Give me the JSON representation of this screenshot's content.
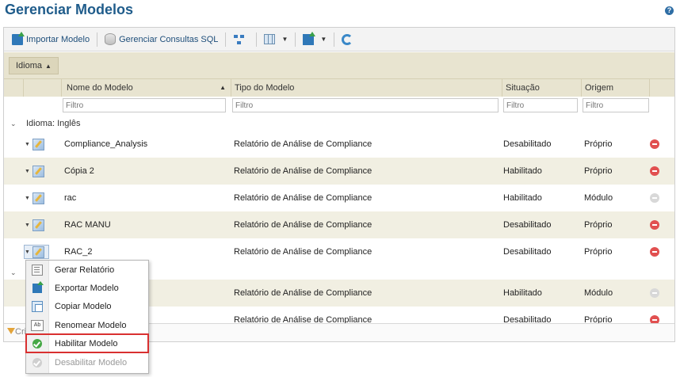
{
  "page": {
    "title": "Gerenciar Modelos",
    "help": "?"
  },
  "toolbar": {
    "import_label": "Importar Modelo",
    "sql_label": "Gerenciar Consultas SQL"
  },
  "grouping": {
    "chip_label": "Idioma"
  },
  "columns": {
    "name": "Nome do Modelo",
    "type": "Tipo do Modelo",
    "status": "Situação",
    "origin": "Origem"
  },
  "filters": {
    "name_placeholder": "Filtro",
    "type_placeholder": "Filtro",
    "status_placeholder": "Filtro",
    "origin_placeholder": "Filtro"
  },
  "group1": {
    "label": "Idioma: Inglês"
  },
  "rows": [
    {
      "name": "Compliance_Analysis",
      "type": "Relatório de Análise de Compliance",
      "status": "Desabilitado",
      "origin": "Próprio",
      "action": "red"
    },
    {
      "name": "Cópia 2",
      "type": "Relatório de Análise de Compliance",
      "status": "Habilitado",
      "origin": "Próprio",
      "action": "red"
    },
    {
      "name": "rac",
      "type": "Relatório de Análise de Compliance",
      "status": "Habilitado",
      "origin": "Módulo",
      "action": "grey"
    },
    {
      "name": "RAC MANU",
      "type": "Relatório de Análise de Compliance",
      "status": "Desabilitado",
      "origin": "Próprio",
      "action": "red"
    },
    {
      "name": "RAC_2",
      "type": "Relatório de Análise de Compliance",
      "status": "Desabilitado",
      "origin": "Próprio",
      "action": "red"
    }
  ],
  "rows2": [
    {
      "type": "Relatório de Análise de Compliance",
      "status": "Habilitado",
      "origin": "Módulo",
      "action": "grey"
    },
    {
      "type": "Relatório de Análise de Compliance",
      "status": "Desabilitado",
      "origin": "Próprio",
      "action": "red"
    }
  ],
  "footer": {
    "text": "Cri"
  },
  "context_menu": {
    "items": [
      {
        "label": "Gerar Relatório",
        "icon": "report-icon"
      },
      {
        "label": "Exportar Modelo",
        "icon": "export-icon"
      },
      {
        "label": "Copiar Modelo",
        "icon": "copy-icon"
      },
      {
        "label": "Renomear Modelo",
        "icon": "rename-icon"
      },
      {
        "label": "Habilitar Modelo",
        "icon": "enable-icon"
      },
      {
        "label": "Desabilitar Modelo",
        "icon": "disable-icon"
      }
    ]
  },
  "colors": {
    "accent": "#1f5c8b",
    "header_bg": "#e8e4d0",
    "alt_row": "#f1efe2",
    "highlight": "#d93030"
  }
}
